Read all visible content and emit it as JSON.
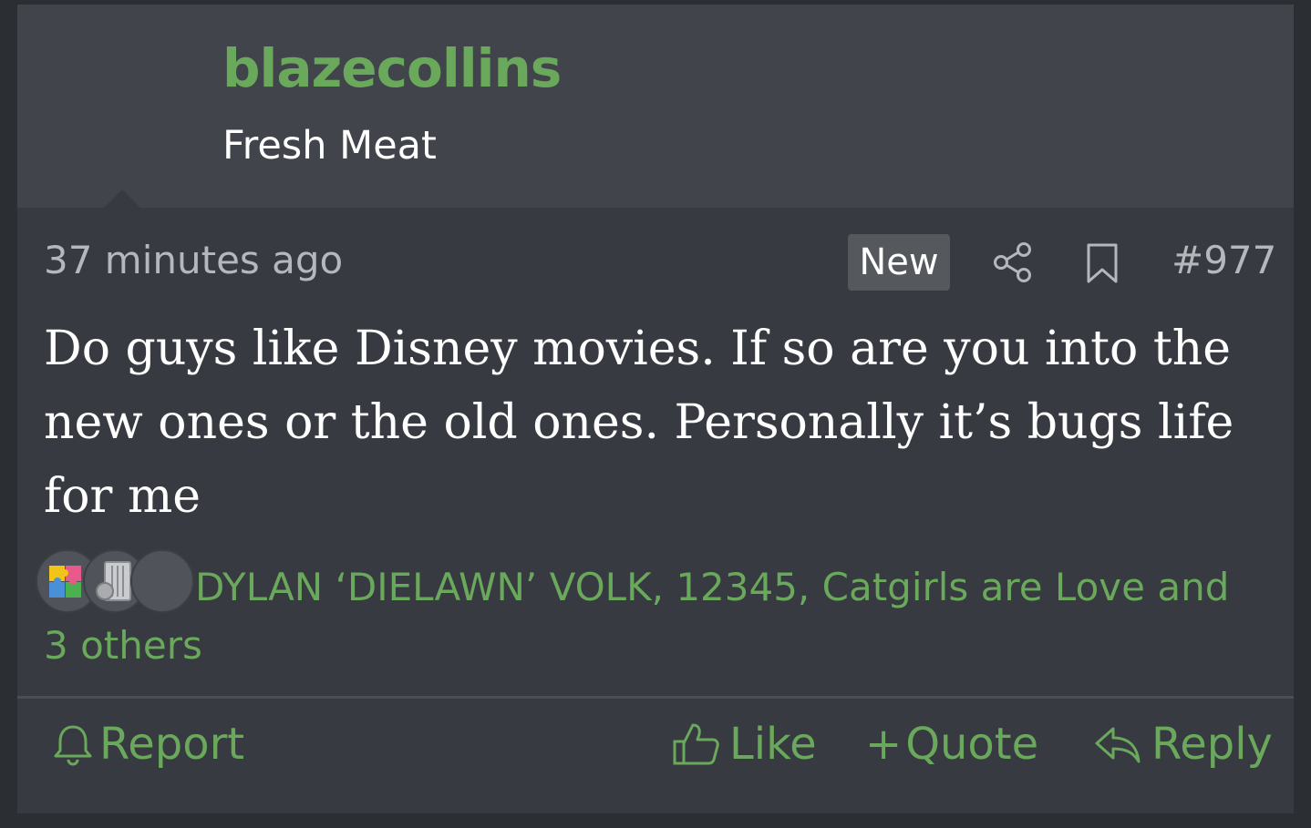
{
  "user": {
    "username": "blazecollins",
    "title": "Fresh Meat"
  },
  "post": {
    "timestamp": "37 minutes ago",
    "badge": "New",
    "number": "#977",
    "body": "Do guys like Disney movies. If so are you into the new ones or the old ones. Personally it’s bugs life for me"
  },
  "reactions": {
    "icons": [
      "puzzle-icon",
      "trash-can-icon",
      "moon-icon"
    ],
    "summary": "DYLAN ‘DIELAWN’ VOLK, 12345, Catgirls are Love and 3 others"
  },
  "actions": {
    "report": "Report",
    "like": "Like",
    "quote": "Quote",
    "reply": "Reply"
  },
  "colors": {
    "accent": "#6aa85c",
    "background": "#373a40",
    "header": "#41444a"
  }
}
